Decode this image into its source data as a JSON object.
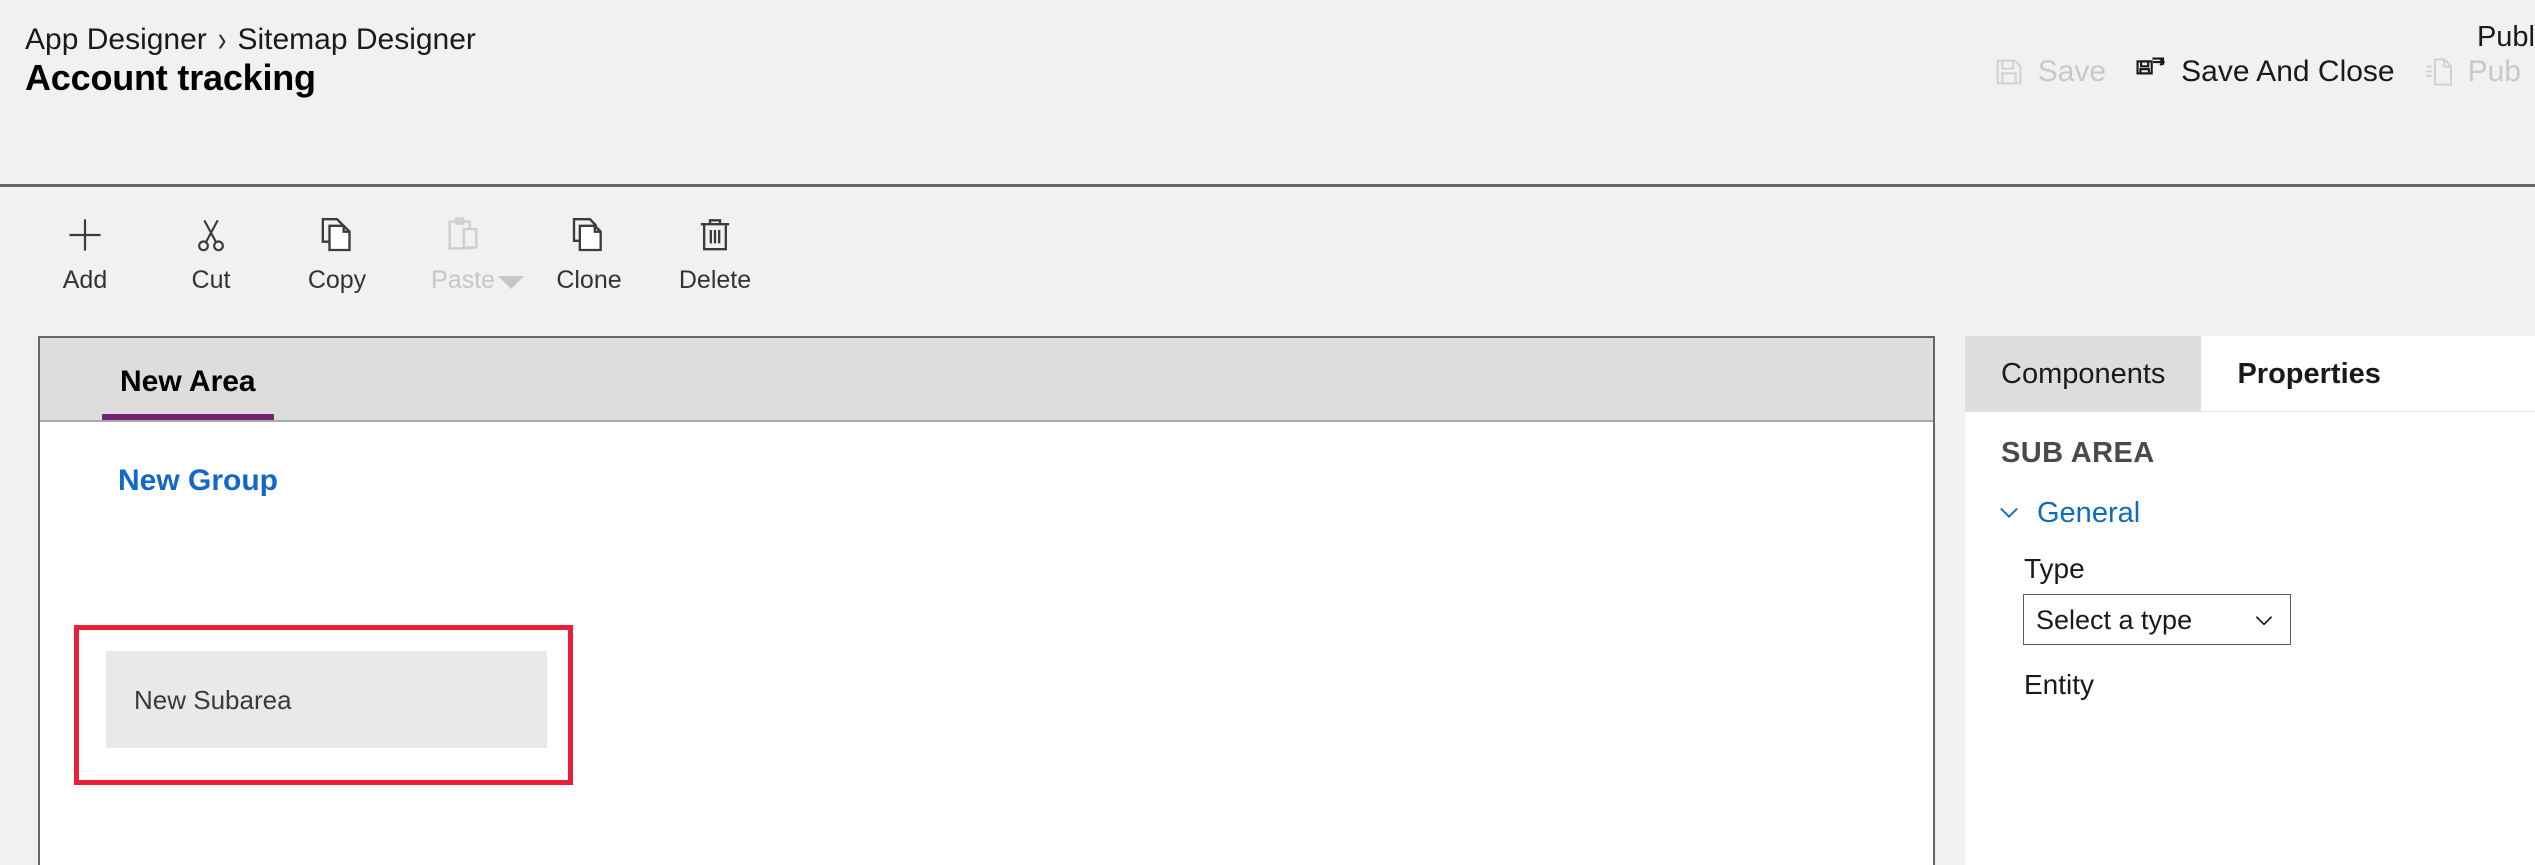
{
  "header": {
    "breadcrumb": {
      "parent": "App Designer",
      "separator": "›",
      "current": "Sitemap Designer"
    },
    "title": "Account tracking",
    "publish_status_label": "Publ",
    "actions": [
      {
        "label": "Save",
        "icon": "save-icon",
        "enabled": false
      },
      {
        "label": "Save And Close",
        "icon": "save-and-close-icon",
        "enabled": true
      },
      {
        "label": "Pub",
        "icon": "publish-icon",
        "enabled": false
      }
    ]
  },
  "command_bar": {
    "buttons": [
      {
        "label": "Add",
        "icon": "plus-icon",
        "enabled": true,
        "has_dropdown": false
      },
      {
        "label": "Cut",
        "icon": "scissors-icon",
        "enabled": true,
        "has_dropdown": false
      },
      {
        "label": "Copy",
        "icon": "copy-icon",
        "enabled": true,
        "has_dropdown": false
      },
      {
        "label": "Paste",
        "icon": "clipboard-icon",
        "enabled": false,
        "has_dropdown": true
      },
      {
        "label": "Clone",
        "icon": "clone-icon",
        "enabled": true,
        "has_dropdown": false
      },
      {
        "label": "Delete",
        "icon": "trash-icon",
        "enabled": true,
        "has_dropdown": false
      }
    ]
  },
  "canvas": {
    "area_tab": "New Area",
    "group_title": "New Group",
    "subarea_label": "New Subarea",
    "selection_color": "#e81f37",
    "tab_accent_color": "#702670",
    "group_link_color": "#1367c8"
  },
  "properties_panel": {
    "tabs": [
      {
        "label": "Components",
        "active": false
      },
      {
        "label": "Properties",
        "active": true
      }
    ],
    "heading": "SUB AREA",
    "sections": [
      {
        "label": "General",
        "expanded": true,
        "fields": [
          {
            "label": "Type",
            "control": "select",
            "value": "Select a type"
          },
          {
            "label": "Entity",
            "control": "select",
            "value": ""
          }
        ]
      }
    ]
  }
}
